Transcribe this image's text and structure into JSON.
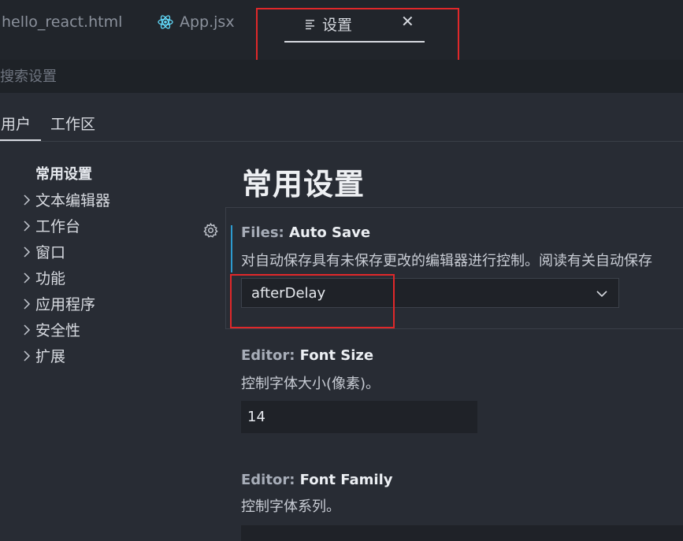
{
  "tabs": [
    {
      "label": "hello_react.html",
      "icon": "html-file-icon"
    },
    {
      "label": "App.jsx",
      "icon": "react-icon"
    },
    {
      "label": "设置",
      "icon": "settings-editor-icon",
      "active": true,
      "close": "✕"
    }
  ],
  "search": {
    "placeholder": "搜索设置"
  },
  "scope_tabs": [
    {
      "label": "用户",
      "active": true
    },
    {
      "label": "工作区"
    }
  ],
  "toc": {
    "title": "常用设置",
    "items": [
      "文本编辑器",
      "工作台",
      "窗口",
      "功能",
      "应用程序",
      "安全性",
      "扩展"
    ]
  },
  "section_title": "常用设置",
  "settings": [
    {
      "category": "Files: ",
      "name": "Auto Save",
      "description": "对自动保存具有未保存更改的编辑器进行控制。阅读有关自动保存",
      "value": "afterDelay"
    },
    {
      "category": "Editor: ",
      "name": "Font Size",
      "description": "控制字体大小(像素)。",
      "value": "14"
    },
    {
      "category": "Editor: ",
      "name": "Font Family",
      "description": "控制字体系列。",
      "value": ""
    }
  ],
  "colors": {
    "highlight": "#e0282a",
    "focus": "#2d9bd0",
    "react": "#61dafb"
  }
}
